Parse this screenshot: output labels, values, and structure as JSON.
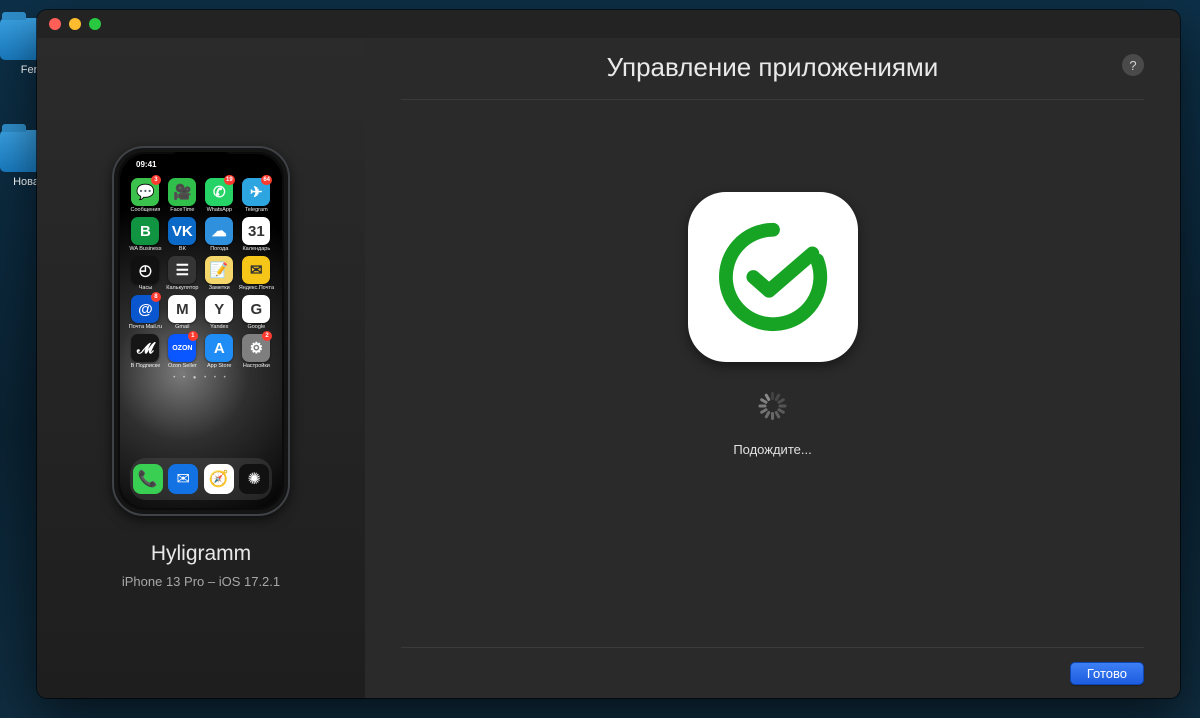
{
  "desktop": {
    "folder_left_top": "Fer",
    "folder_left_bottom": "Новая"
  },
  "window": {
    "sidebar": {
      "device_name": "Hyligramm",
      "device_model_os": "iPhone 13 Pro – iOS 17.2.1",
      "status_time": "09:41",
      "home_apps": [
        {
          "label": "Сообщения",
          "color": "#3ac24c",
          "glyph": "💬",
          "badge": "3"
        },
        {
          "label": "FaceTime",
          "color": "#2fbf4a",
          "glyph": "🎥",
          "badge": ""
        },
        {
          "label": "WhatsApp",
          "color": "#25d366",
          "glyph": "✆",
          "badge": "19"
        },
        {
          "label": "Telegram",
          "color": "#2da5e1",
          "glyph": "✈",
          "badge": "64"
        },
        {
          "label": "WA Business",
          "color": "#109441",
          "glyph": "B",
          "badge": ""
        },
        {
          "label": "ВК",
          "color": "#0b69c7",
          "glyph": "VK",
          "badge": ""
        },
        {
          "label": "Погода",
          "color": "#2f90de",
          "glyph": "☁",
          "badge": ""
        },
        {
          "label": "Календарь",
          "color": "#ffffff",
          "glyph": "31",
          "badge": ""
        },
        {
          "label": "Часы",
          "color": "#111111",
          "glyph": "◴",
          "badge": ""
        },
        {
          "label": "Калькулятор",
          "color": "#353535",
          "glyph": "☰",
          "badge": ""
        },
        {
          "label": "Заметки",
          "color": "#f5d66a",
          "glyph": "📝",
          "badge": ""
        },
        {
          "label": "Яндекс.Почта",
          "color": "#f5c518",
          "glyph": "✉",
          "badge": ""
        },
        {
          "label": "Почта Mail.ru",
          "color": "#0a56cf",
          "glyph": "@",
          "badge": "8"
        },
        {
          "label": "Gmail",
          "color": "#ffffff",
          "glyph": "M",
          "badge": ""
        },
        {
          "label": "Yandex",
          "color": "#ffffff",
          "glyph": "Y",
          "badge": ""
        },
        {
          "label": "Google",
          "color": "#ffffff",
          "glyph": "G",
          "badge": ""
        },
        {
          "label": "В Подписке",
          "color": "#161616",
          "glyph": "𝓜",
          "badge": ""
        },
        {
          "label": "Ozon Seller",
          "color": "#0b57ff",
          "glyph": "OZON",
          "badge": "1"
        },
        {
          "label": "App Store",
          "color": "#1f8df5",
          "glyph": "A",
          "badge": ""
        },
        {
          "label": "Настройки",
          "color": "#7f7f7f",
          "glyph": "⚙",
          "badge": "2"
        }
      ],
      "dock_apps": [
        {
          "label": "Phone",
          "color": "#38cf53",
          "glyph": "📞"
        },
        {
          "label": "Mail",
          "color": "#1271e3",
          "glyph": "✉"
        },
        {
          "label": "Safari",
          "color": "#ffffff",
          "glyph": "🧭"
        },
        {
          "label": "Камера",
          "color": "#111111",
          "glyph": "✺"
        }
      ]
    },
    "content": {
      "title": "Управление приложениями",
      "help_glyph": "?",
      "icon_accent": "#17a424",
      "wait_label": "Подождите...",
      "done_label": "Готово"
    }
  }
}
